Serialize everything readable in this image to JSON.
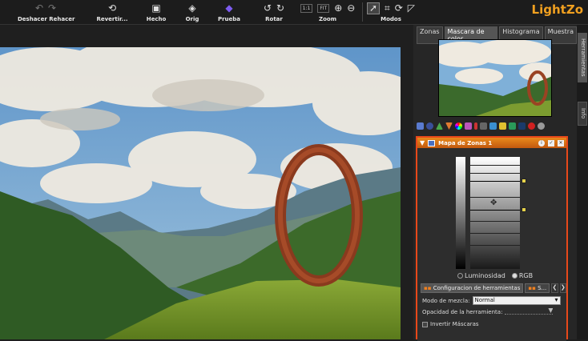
{
  "app": {
    "logo": "LightZo"
  },
  "toolbar": {
    "undo_redo_label": "Deshacer Rehacer",
    "revert_label": "Revertir...",
    "done_label": "Hecho",
    "orig_label": "Orig",
    "proof_label": "Prueba",
    "rotate_label": "Rotar",
    "zoom_label": "Zoom",
    "zoom_1to1": "1:1",
    "zoom_fit": "FIT",
    "modes_label": "Modos"
  },
  "panel": {
    "tabs": [
      "Zonas",
      "Mascara de color",
      "Histograma",
      "Muestra"
    ],
    "active_tab_index": 1
  },
  "zone_tool": {
    "title": "Mapa de Zonas 1",
    "luminosity_label": "Luminosidad",
    "rgb_label": "RGB",
    "selected_mode": "RGB",
    "config_tab_label": "Configuracion de herramientas",
    "second_tab_label": "S...",
    "blend_mode_label": "Modo de mezcla:",
    "blend_mode_value": "Normal",
    "opacity_label": "Opacidad de la herramienta:",
    "opacity_fraction": 1.0,
    "invert_masks_label": "Invertir Máscaras",
    "invert_masks_checked": false
  },
  "side_tabs": [
    "Herramientas",
    "Info"
  ],
  "colors": {
    "accent": "#e8481a",
    "header_orange": "#e88a1c",
    "logo": "#f0a020"
  }
}
